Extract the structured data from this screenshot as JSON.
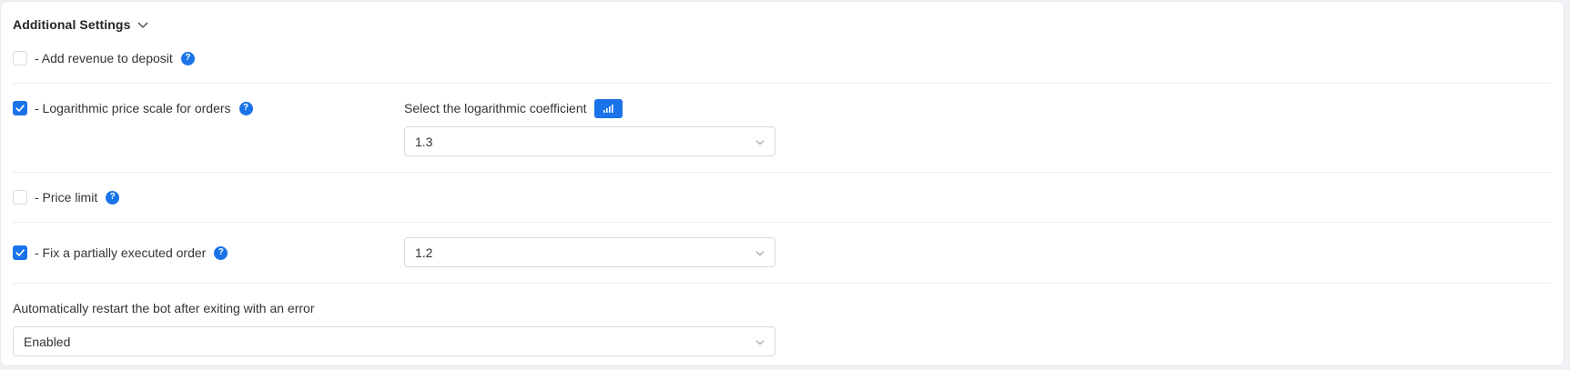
{
  "section": {
    "title": "Additional Settings",
    "toggle_icon": "chevron-down-icon"
  },
  "settings": {
    "add_revenue": {
      "label": "- Add revenue to deposit",
      "checked": false
    },
    "log_scale": {
      "label": "- Logarithmic price scale for orders",
      "checked": true,
      "coef_label": "Select the logarithmic coefficient",
      "coef_value": "1.3",
      "chart_icon": "bar-chart-icon"
    },
    "price_limit": {
      "label": "- Price limit",
      "checked": false
    },
    "fix_partial": {
      "label": "- Fix a partially executed order",
      "checked": true,
      "value": "1.2"
    },
    "auto_restart": {
      "label": "Automatically restart the bot after exiting with an error",
      "value": "Enabled"
    }
  },
  "help_icon_text": "?",
  "colors": {
    "accent": "#1a73e8",
    "border": "#d9d9d9",
    "divider": "#ebedf0",
    "text": "#333333"
  }
}
